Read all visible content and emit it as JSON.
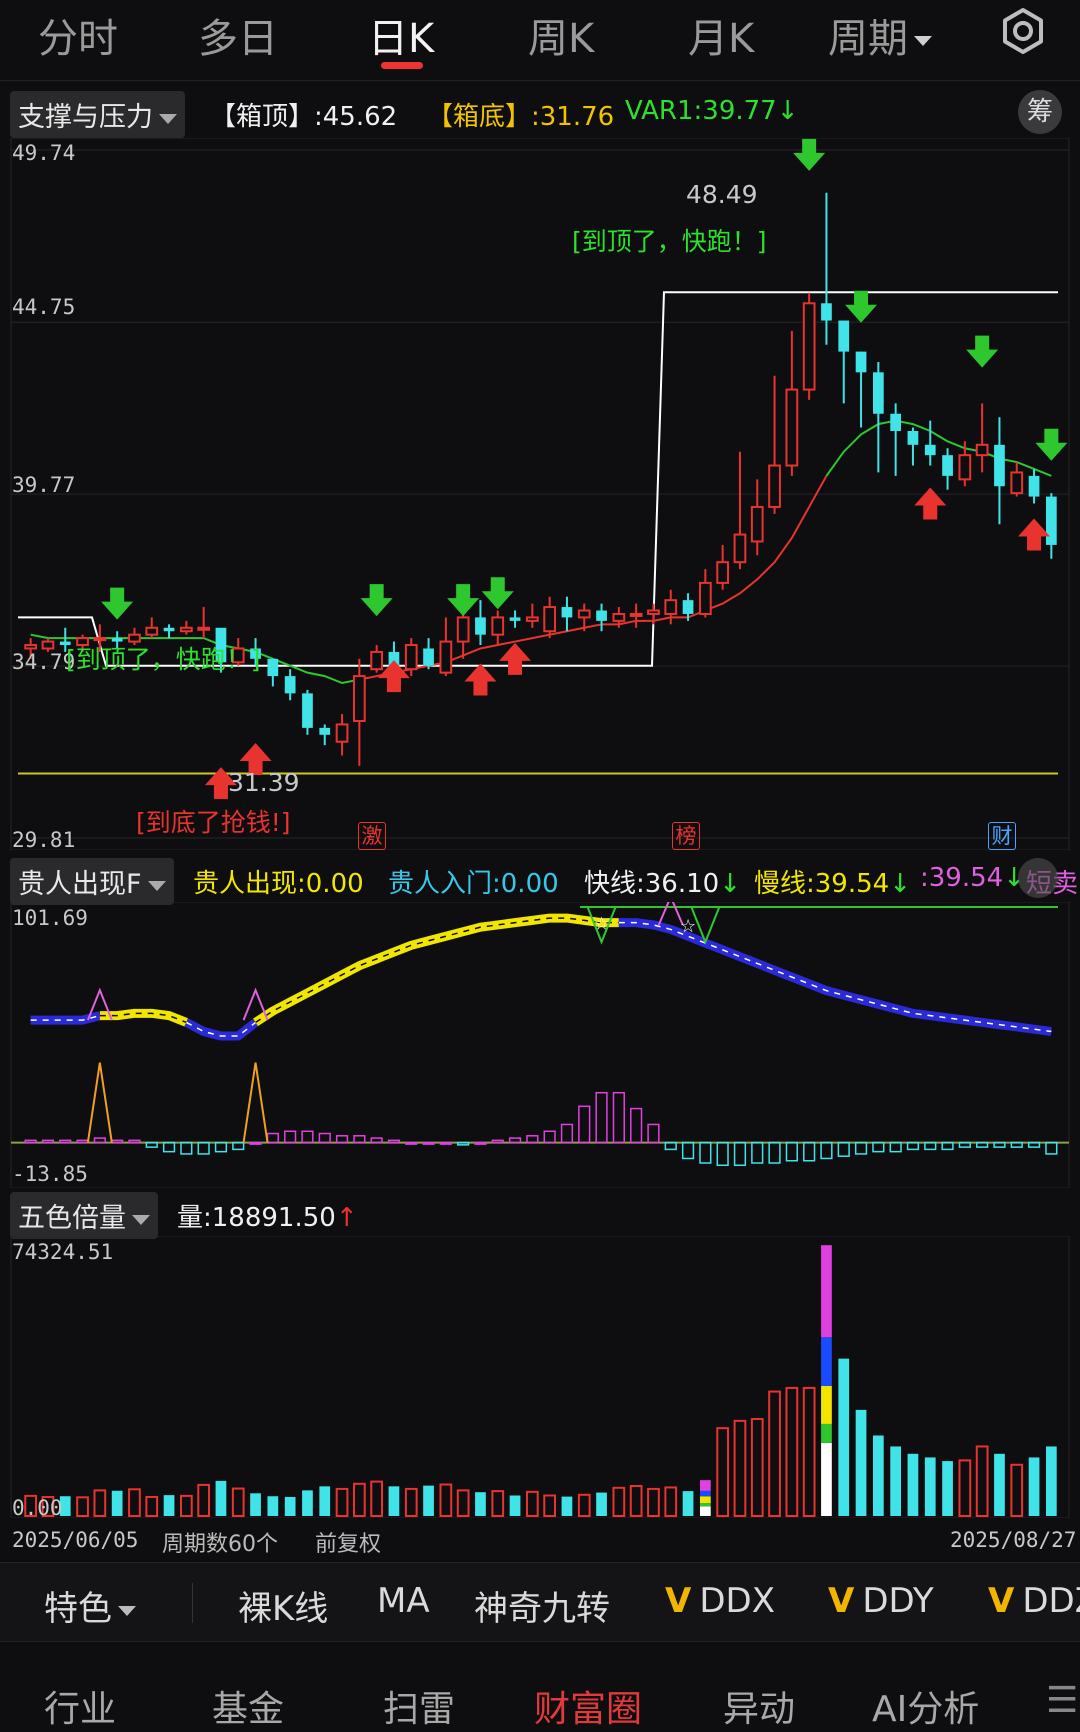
{
  "tabs": [
    {
      "label": "分时",
      "active": false
    },
    {
      "label": "多日",
      "active": false
    },
    {
      "label": "日K",
      "active": true
    },
    {
      "label": "周K",
      "active": false
    },
    {
      "label": "月K",
      "active": false
    },
    {
      "label": "周期",
      "active": false
    }
  ],
  "settings_icon": "gear-icon",
  "main_indicator": {
    "select_label": "支撑与压力",
    "box_top": "【箱顶】:45.62",
    "box_bottom": "【箱底】:31.76",
    "var1": "VAR1:39.77",
    "arrow": "↓",
    "chip_label": "筹",
    "y_labels": [
      "49.74",
      "44.75",
      "39.77",
      "34.79",
      "29.81"
    ],
    "high_label": "48.49",
    "low_label": "31.39",
    "top_text_1": "[到顶了，快跑！]",
    "top_text_2": "[到顶了，快跑！]",
    "bottom_text": "[到底了抢钱!]",
    "badges": [
      "激",
      "榜",
      "财"
    ]
  },
  "indicator2": {
    "select_label": "贵人出现F",
    "v1": "贵人出现:0.00",
    "v2": "贵人入门:0.00",
    "v3": "快线:36.10",
    "v3_arrow": "↓",
    "v4": "慢线:39.54",
    "v4_arrow": "↓",
    "v5": ":39.54",
    "v5_arrow": "↓",
    "v6": "短卖",
    "y_top": "101.69",
    "y_bottom": "-13.85"
  },
  "indicator3": {
    "select_label": "五色倍量",
    "volume": "量:18891.50",
    "volume_arrow": "↑",
    "y_top": "74324.51",
    "y_bottom": "0.00"
  },
  "date_axis": {
    "start": "2025/06/05",
    "period_count": "周期数60个",
    "adjust": "前复权",
    "end": "2025/08/27"
  },
  "toolbar": {
    "special": "特色",
    "items": [
      "裸K线",
      "MA",
      "神奇九转"
    ],
    "v_items": [
      "DDX",
      "DDY",
      "DDZ"
    ]
  },
  "bottom_nav": [
    "行业",
    "基金",
    "扫雷",
    "财富圈",
    "异动",
    "AI分析"
  ],
  "bottom_nav_active": 3,
  "colors": {
    "up": "#e8332f",
    "down": "#3fe3e8",
    "ma": "#2ec82e",
    "box": "#ffffff",
    "support": "#c8c820",
    "accent": "#e23a3a"
  },
  "chart_data": {
    "type": "candlestick",
    "x_range": [
      "2025/06/05",
      "2025/08/27"
    ],
    "ylim": [
      29.81,
      49.74
    ],
    "candles": [
      [
        35.3,
        35.4,
        35.6,
        35.0
      ],
      [
        35.3,
        35.5,
        35.6,
        35.2
      ],
      [
        35.5,
        35.4,
        35.9,
        35.2
      ],
      [
        35.4,
        35.6,
        35.7,
        35.2
      ],
      [
        35.6,
        35.6,
        36.0,
        35.2
      ],
      [
        35.6,
        35.5,
        35.8,
        35.3
      ],
      [
        35.5,
        35.7,
        35.9,
        35.4
      ],
      [
        35.7,
        35.9,
        36.2,
        35.6
      ],
      [
        35.9,
        35.8,
        36.0,
        35.6
      ],
      [
        35.8,
        35.9,
        36.1,
        35.7
      ],
      [
        35.9,
        35.9,
        36.5,
        35.6
      ],
      [
        35.9,
        34.9,
        35.0,
        34.6
      ],
      [
        34.9,
        35.3,
        35.6,
        34.8
      ],
      [
        35.3,
        35.0,
        35.6,
        34.8
      ],
      [
        35.0,
        34.5,
        35.0,
        34.2
      ],
      [
        34.5,
        34.0,
        34.7,
        33.8
      ],
      [
        34.0,
        33.0,
        34.1,
        32.8
      ],
      [
        33.0,
        32.8,
        33.1,
        32.5
      ],
      [
        32.6,
        33.1,
        33.4,
        32.2
      ],
      [
        33.2,
        34.5,
        35.0,
        31.9
      ],
      [
        34.7,
        35.2,
        35.4,
        34.6
      ],
      [
        35.2,
        34.6,
        35.5,
        34.5
      ],
      [
        34.7,
        35.4,
        35.6,
        34.5
      ],
      [
        35.3,
        34.8,
        35.6,
        34.7
      ],
      [
        34.6,
        35.5,
        36.2,
        34.5
      ],
      [
        35.5,
        36.2,
        36.3,
        35.0
      ],
      [
        36.2,
        35.7,
        36.7,
        35.4
      ],
      [
        35.7,
        36.2,
        36.4,
        35.4
      ],
      [
        36.2,
        36.1,
        36.4,
        35.9
      ],
      [
        36.1,
        36.2,
        36.6,
        35.9
      ],
      [
        35.8,
        36.5,
        36.8,
        35.6
      ],
      [
        36.5,
        36.2,
        36.8,
        35.8
      ],
      [
        36.2,
        36.4,
        36.6,
        35.8
      ],
      [
        36.4,
        36.1,
        36.6,
        35.8
      ],
      [
        36.1,
        36.3,
        36.5,
        35.9
      ],
      [
        36.3,
        36.3,
        36.6,
        35.9
      ],
      [
        36.3,
        36.4,
        36.6,
        36.0
      ],
      [
        36.3,
        36.7,
        37.0,
        36.0
      ],
      [
        36.7,
        36.3,
        36.9,
        36.1
      ],
      [
        36.3,
        37.2,
        37.6,
        36.2
      ],
      [
        37.2,
        37.8,
        38.3,
        37.0
      ],
      [
        37.8,
        38.6,
        41.0,
        37.6
      ],
      [
        38.4,
        39.4,
        40.2,
        38.0
      ],
      [
        39.4,
        40.6,
        43.2,
        39.2
      ],
      [
        40.6,
        42.8,
        44.5,
        40.3
      ],
      [
        42.8,
        45.3,
        45.6,
        42.5
      ],
      [
        45.3,
        44.8,
        48.5,
        44.1
      ],
      [
        44.8,
        43.9,
        44.8,
        42.4
      ],
      [
        43.9,
        43.3,
        43.9,
        41.7
      ],
      [
        43.3,
        42.1,
        43.6,
        40.4
      ],
      [
        42.1,
        41.6,
        42.4,
        40.3
      ],
      [
        41.6,
        41.2,
        41.7,
        40.6
      ],
      [
        41.2,
        40.9,
        41.9,
        40.6
      ],
      [
        40.9,
        40.3,
        41.1,
        39.9
      ],
      [
        40.2,
        40.9,
        41.3,
        40.0
      ],
      [
        40.9,
        41.2,
        42.4,
        40.4
      ],
      [
        41.2,
        40.0,
        42.0,
        38.9
      ],
      [
        39.8,
        40.4,
        40.7,
        39.7
      ],
      [
        40.3,
        39.7,
        40.5,
        39.5
      ],
      [
        39.7,
        38.3,
        39.8,
        37.9
      ]
    ],
    "ma": [
      35.7,
      35.6,
      35.6,
      35.6,
      35.6,
      35.6,
      35.6,
      35.6,
      35.6,
      35.6,
      35.6,
      35.4,
      35.3,
      35.2,
      35.0,
      34.8,
      34.6,
      34.5,
      34.3,
      34.4,
      34.5,
      34.6,
      34.7,
      34.8,
      34.9,
      35.1,
      35.3,
      35.4,
      35.5,
      35.6,
      35.7,
      35.8,
      35.9,
      36.0,
      36.0,
      36.1,
      36.1,
      36.2,
      36.2,
      36.4,
      36.6,
      36.9,
      37.3,
      37.8,
      38.5,
      39.4,
      40.3,
      41.0,
      41.5,
      41.8,
      41.9,
      41.8,
      41.6,
      41.3,
      41.1,
      41.0,
      40.8,
      40.7,
      40.5,
      40.3
    ],
    "box_top": 45.62,
    "box_bottom": 31.76,
    "support_line": 31.39,
    "annotations": [
      "48.49",
      "31.39",
      "[到顶了，快跑！]",
      "[到底了抢钱!]"
    ],
    "indicator2_fast": [
      54,
      54,
      54,
      54,
      56,
      56,
      57,
      57,
      56,
      53,
      49,
      47,
      47,
      53,
      58,
      62,
      66,
      70,
      74,
      78,
      81,
      84,
      87,
      89,
      91,
      93,
      95,
      96,
      97,
      98,
      99,
      99,
      98,
      97,
      97,
      97,
      96,
      94,
      91,
      88,
      85,
      82,
      79,
      76,
      73,
      70,
      67,
      65,
      63,
      61,
      59,
      57,
      56,
      55,
      54,
      53,
      52,
      51,
      50,
      49
    ],
    "indicator2_hist": [
      1,
      1,
      1,
      1,
      2,
      1,
      1,
      -2,
      -4,
      -5,
      -5,
      -4,
      -3,
      0,
      4,
      5,
      5,
      4,
      3,
      3,
      2,
      1,
      0,
      0,
      0,
      -1,
      0,
      1,
      2,
      3,
      5,
      8,
      16,
      22,
      22,
      15,
      8,
      -3,
      -7,
      -9,
      -10,
      -10,
      -9,
      -9,
      -8,
      -8,
      -7,
      -6,
      -5,
      -4,
      -4,
      -3,
      -3,
      -3,
      -2,
      -2,
      -2,
      -2,
      -2,
      -5
    ],
    "volume": [
      5500,
      5200,
      5400,
      5100,
      7000,
      6900,
      7300,
      5200,
      5700,
      5500,
      8500,
      9600,
      7500,
      6200,
      5400,
      5200,
      7000,
      8100,
      7400,
      8800,
      9400,
      8100,
      7400,
      8300,
      8600,
      7000,
      6500,
      6800,
      5600,
      6600,
      5600,
      5300,
      5800,
      6400,
      7700,
      8200,
      7400,
      7800,
      6800,
      9800,
      24000,
      26000,
      26500,
      34000,
      35000,
      35000,
      74000,
      43000,
      29000,
      22000,
      19000,
      17000,
      16000,
      15000,
      15200,
      19000,
      17000,
      14000,
      16000,
      19000
    ]
  }
}
